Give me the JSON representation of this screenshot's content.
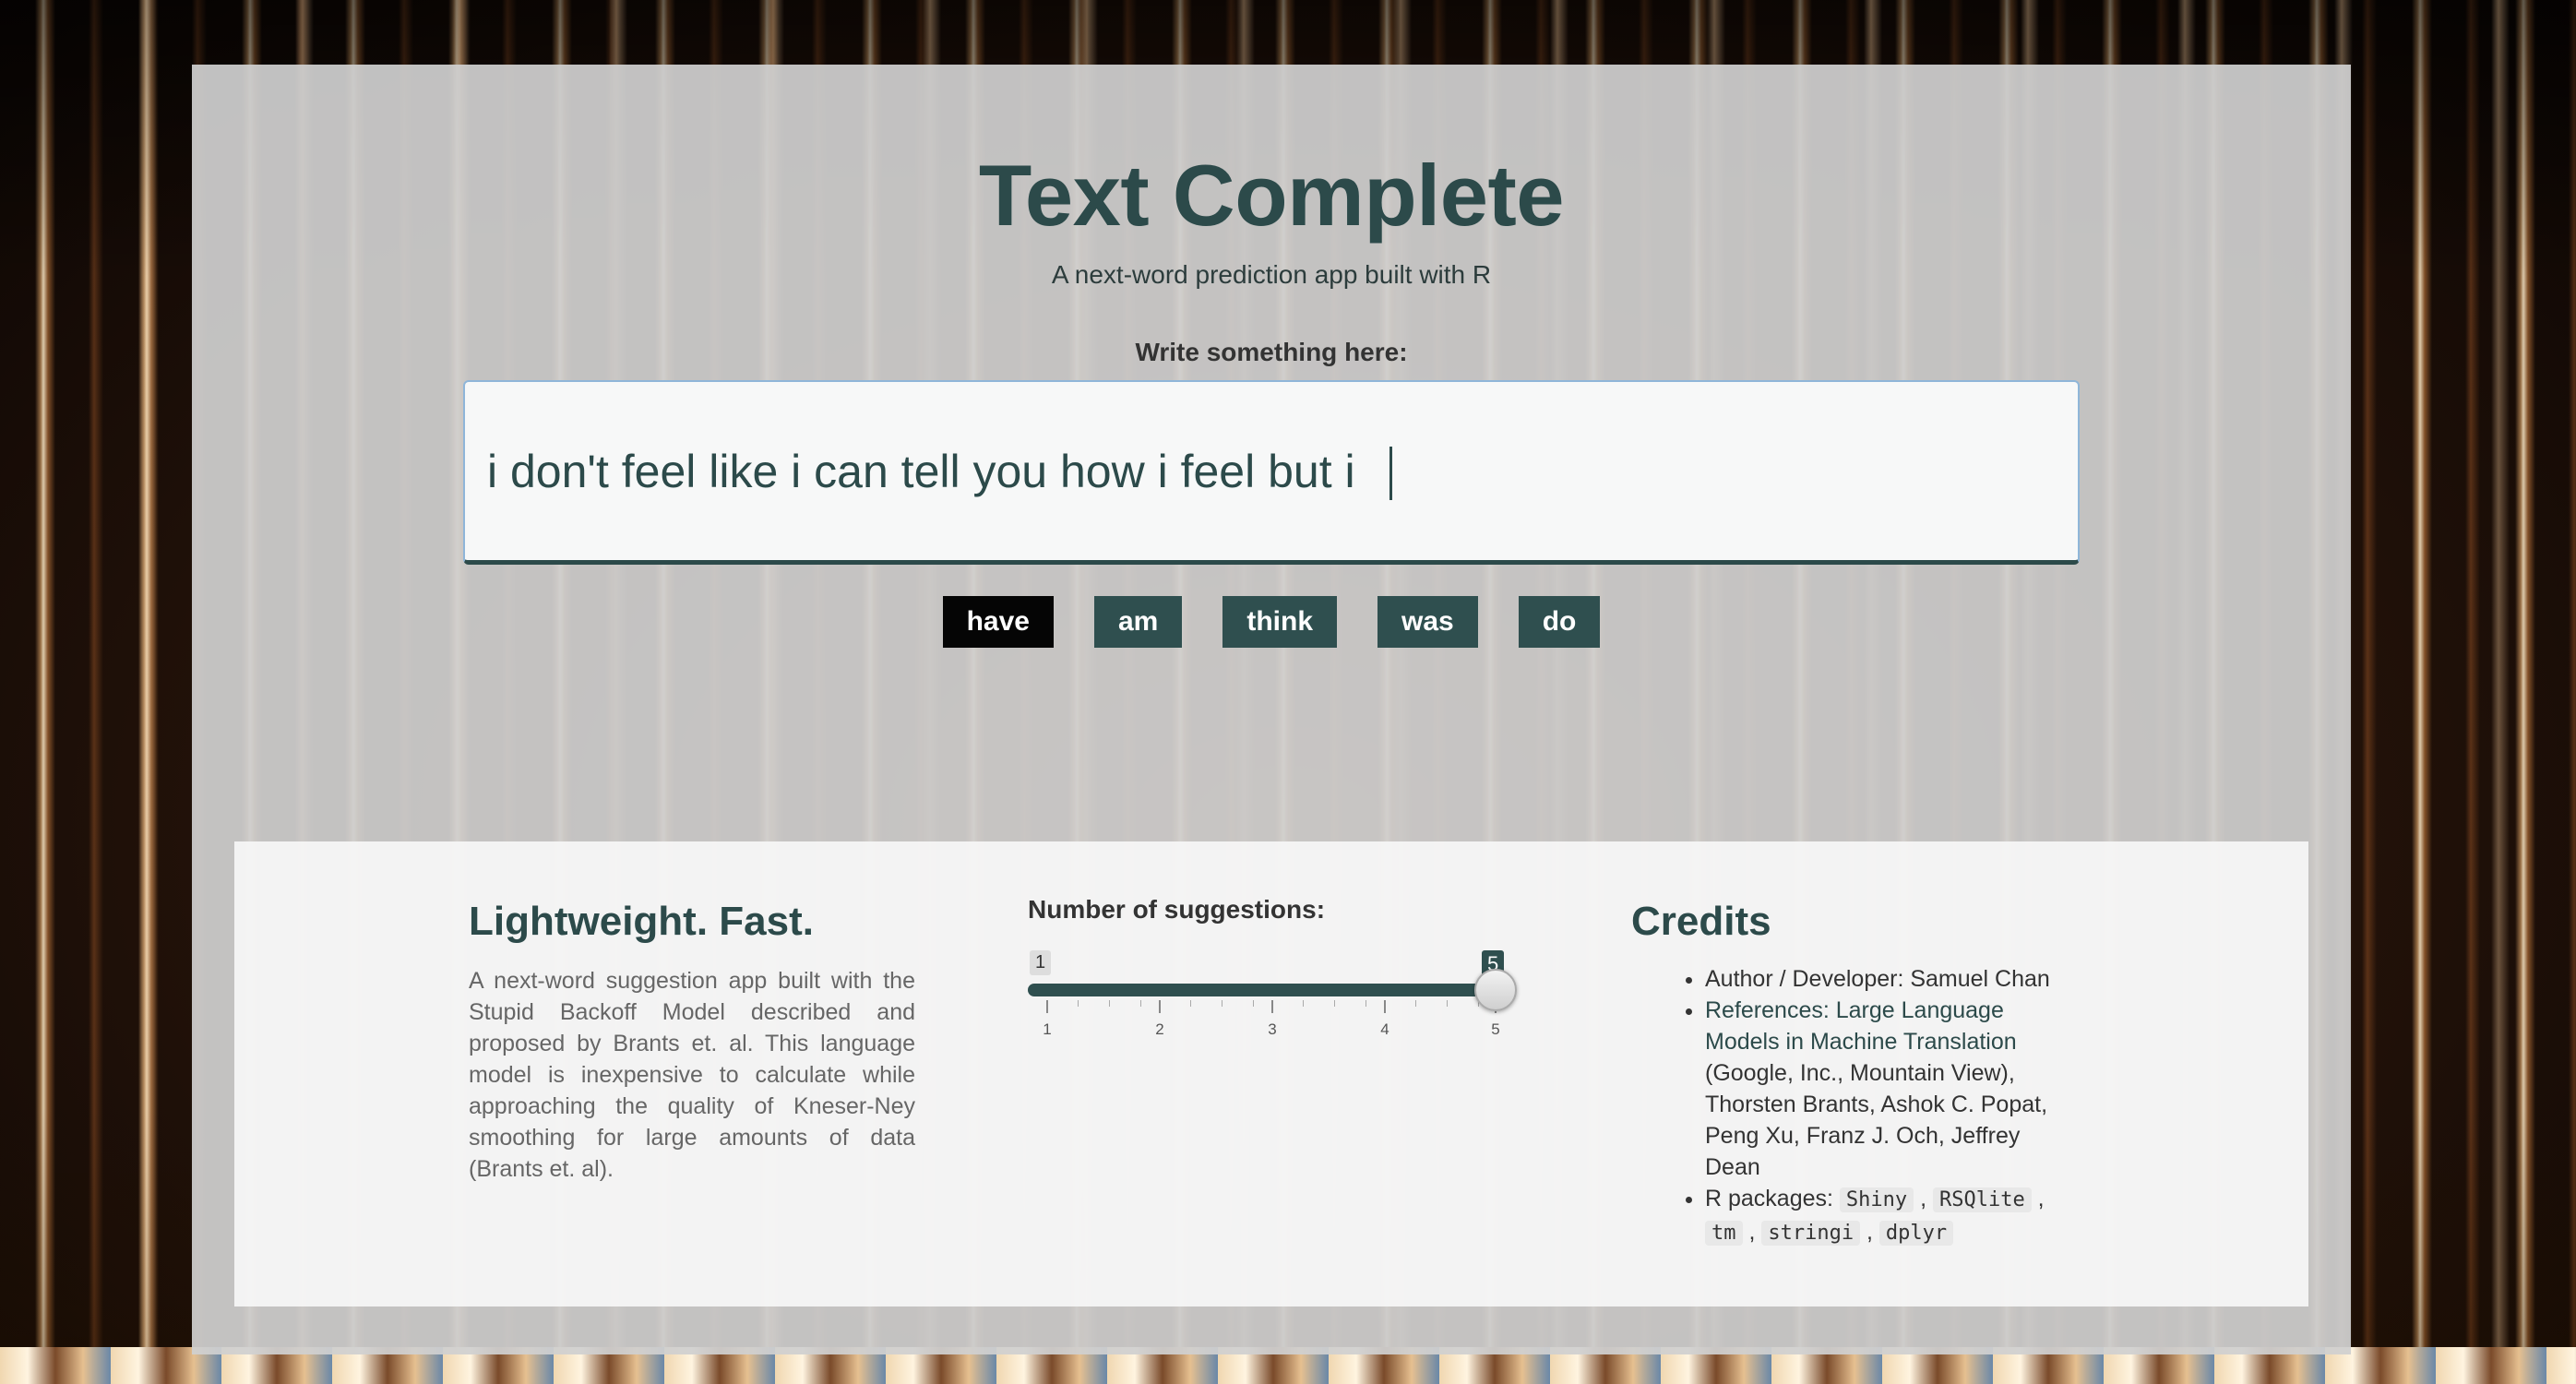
{
  "header": {
    "title": "Text Complete",
    "subtitle": "A next-word prediction app built with R"
  },
  "input": {
    "label": "Write something here:",
    "value": "i don't feel like i can tell you how i feel but i "
  },
  "suggestions": [
    {
      "label": "have",
      "active": true
    },
    {
      "label": "am",
      "active": false
    },
    {
      "label": "think",
      "active": false
    },
    {
      "label": "was",
      "active": false
    },
    {
      "label": "do",
      "active": false
    }
  ],
  "about": {
    "heading": "Lightweight. Fast.",
    "description": "A next-word suggestion app built with the Stupid Backoff Model described and proposed by Brants et. al. This language model is inexpensive to calculate while approaching the quality of Kneser-Ney smoothing for large amounts of data (Brants et. al)."
  },
  "slider": {
    "label": "Number of suggestions:",
    "min": 1,
    "max": 5,
    "value": 5,
    "min_label": "1",
    "value_label": "5",
    "tick_labels": [
      "1",
      "2",
      "3",
      "4",
      "5"
    ]
  },
  "credits": {
    "heading": "Credits",
    "author": "Author / Developer: Samuel Chan",
    "references_prefix": "References:",
    "references_link": "Large Language Models in Machine Translation",
    "references_rest": "(Google, Inc., Mountain View), Thorsten Brants, Ashok C. Popat, Peng Xu, Franz J. Och, Jeffrey Dean",
    "packages_prefix": "R packages:",
    "packages": [
      "Shiny",
      "RSQlite",
      "tm",
      "stringi",
      "dplyr"
    ]
  },
  "colors": {
    "accent": "#2f4f4f",
    "active_suggestion": "#050505"
  }
}
